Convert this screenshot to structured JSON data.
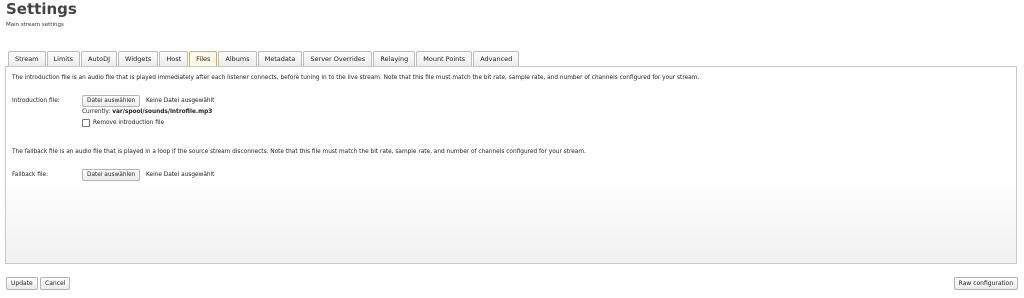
{
  "header": {
    "title": "Settings",
    "subtitle": "Main stream settings"
  },
  "tabs": [
    {
      "label": "Stream",
      "active": false
    },
    {
      "label": "Limits",
      "active": false
    },
    {
      "label": "AutoDJ",
      "active": false
    },
    {
      "label": "Widgets",
      "active": false
    },
    {
      "label": "Host",
      "active": false
    },
    {
      "label": "Files",
      "active": true
    },
    {
      "label": "Albums",
      "active": false
    },
    {
      "label": "Metadata",
      "active": false
    },
    {
      "label": "Server Overrides",
      "active": false
    },
    {
      "label": "Relaying",
      "active": false
    },
    {
      "label": "Mount Points",
      "active": false
    },
    {
      "label": "Advanced",
      "active": false
    }
  ],
  "files": {
    "intro_description": "The introduction file is an audio file that is played immediately after each listener connects, before tuning in to the live stream. Note that this file must match the bit rate, sample rate, and number of channels configured for your stream.",
    "intro_label": "Introduction file:",
    "intro_button": "Datei auswählen",
    "intro_status": "Keine Datei ausgewählt",
    "intro_current_prefix": "Currently:",
    "intro_current_value": "var/spool/sounds/introfile.mp3",
    "remove_intro_label": "Remove introduction file",
    "fallback_description": "The fallback file is an audio file that is played in a loop if the source stream disconnects. Note that this file must match the bit rate, sample rate, and number of channels configured for your stream.",
    "fallback_label": "Fallback file:",
    "fallback_button": "Datei auswählen",
    "fallback_status": "Keine Datei ausgewählt"
  },
  "footer": {
    "update_label": "Update",
    "cancel_label": "Cancel",
    "raw_config_label": "Raw configuration"
  },
  "colors": {
    "active_tab_border": "#e8a93a",
    "active_tab_bg": "#fffbe6"
  }
}
